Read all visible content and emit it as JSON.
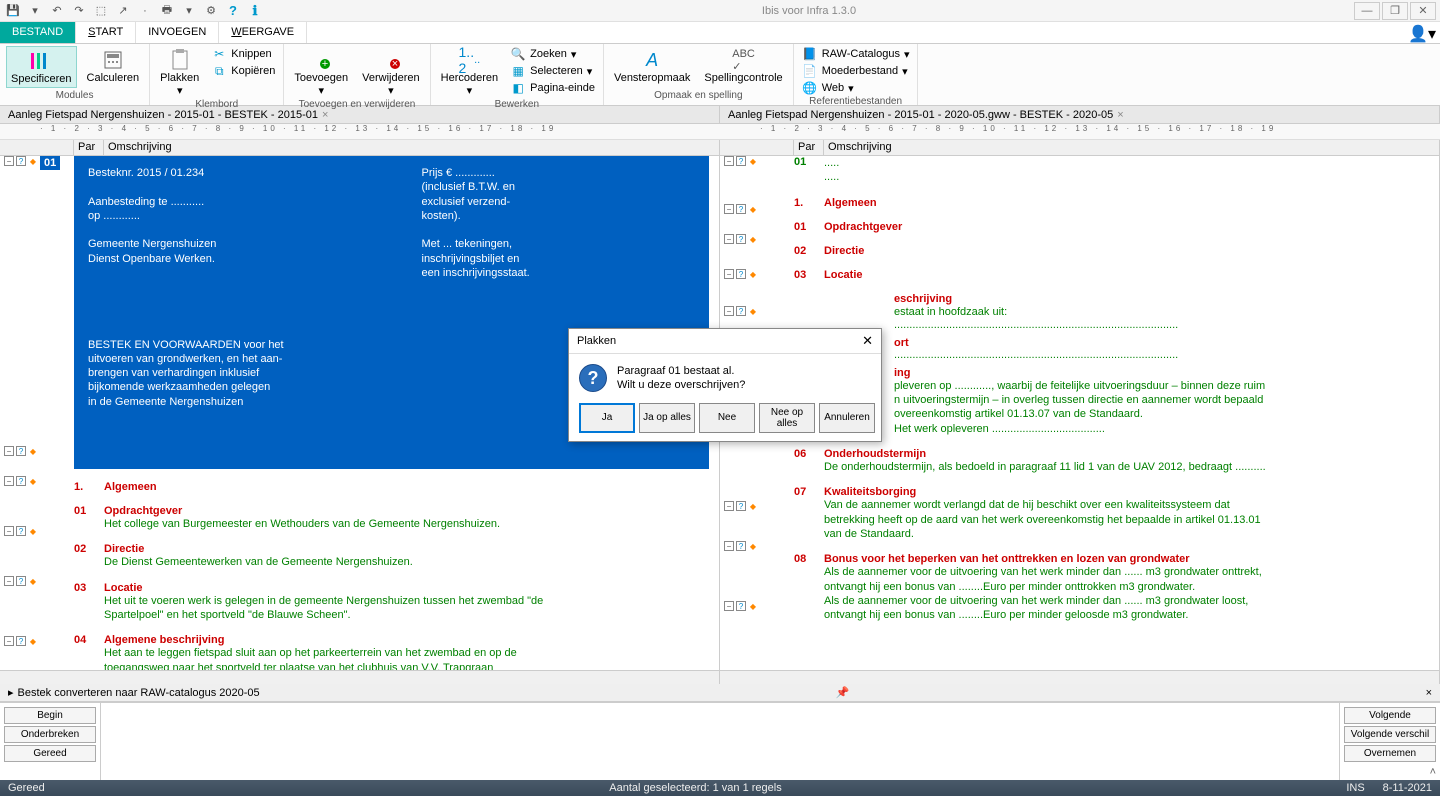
{
  "app_title": "Ibis voor Infra 1.3.0",
  "menu_tabs": {
    "bestand": "BESTAND",
    "start": "START",
    "invoegen": "INVOEGEN",
    "weergave": "WEERGAVE"
  },
  "ribbon": {
    "modules": {
      "label": "Modules",
      "specificeren": "Specificeren",
      "calculeren": "Calculeren"
    },
    "klembord": {
      "label": "Klembord",
      "plakken": "Plakken",
      "knippen": "Knippen",
      "kopieren": "Kopiëren"
    },
    "toevoegen_verwijderen": {
      "label": "Toevoegen en verwijderen",
      "toevoegen": "Toevoegen",
      "verwijderen": "Verwijderen"
    },
    "bewerken": {
      "label": "Bewerken",
      "hercoderen": "Hercoderen",
      "zoeken": "Zoeken",
      "selecteren": "Selecteren",
      "pagina_einde": "Pagina-einde"
    },
    "opmaak": {
      "label": "Opmaak en spelling",
      "vensteropmaak": "Vensteropmaak",
      "spellingcontrole": "Spellingcontrole"
    },
    "referentie": {
      "label": "Referentiebestanden",
      "raw": "RAW-Catalogus",
      "moeder": "Moederbestand",
      "web": "Web"
    }
  },
  "doc_tabs": {
    "left": "Aanleg Fietspad Nergenshuizen - 2015-01 - BESTEK - 2015-01",
    "right": "Aanleg Fietspad Nergenshuizen - 2015-01 - 2020-05.gww - BESTEK - 2020-05"
  },
  "col_headers": {
    "par": "Par",
    "omschrijving": "Omschrijving"
  },
  "left_doc": {
    "par01": "01",
    "blue": {
      "besteknr": "Besteknr. 2015 / 01.234",
      "aanbesteding": "Aanbesteding te ...........",
      "op": "op ............",
      "gemeente": "Gemeente Nergenshuizen",
      "dienst": "Dienst Openbare Werken.",
      "voorwaarden1": "BESTEK EN VOORWAARDEN voor het",
      "voorwaarden2": "uitvoeren van grondwerken, en het aan-",
      "voorwaarden3": "brengen van verhardingen inklusief",
      "voorwaarden4": "bijkomende werkzaamheden gelegen",
      "voorwaarden5": "in de Gemeente Nergenshuizen",
      "prijs": "Prijs € .............",
      "incl": "(inclusief B.T.W. en",
      "excl": "exclusief verzend-",
      "kosten": "kosten).",
      "met": "Met ... tekeningen,",
      "inschr": "inschrijvingsbiljet en",
      "staat": "een inschrijvingsstaat."
    },
    "sections": [
      {
        "num": "1.",
        "title": "Algemeen"
      },
      {
        "num": "01",
        "title": "Opdrachtgever",
        "body": "Het college van Burgemeester en Wethouders van de Gemeente Nergenshuizen."
      },
      {
        "num": "02",
        "title": "Directie",
        "body": "De Dienst Gemeentewerken van de Gemeente Nergenshuizen."
      },
      {
        "num": "03",
        "title": "Locatie",
        "body1": "Het uit te voeren werk is gelegen in de gemeente Nergenshuizen tussen het zwembad \"de",
        "body2": "Spartelpoel\" en het sportveld \"de Blauwe Scheen\"."
      },
      {
        "num": "04",
        "title": "Algemene beschrijving",
        "body1": "Het aan te leggen fietspad sluit aan op het parkeerterrein van het zwembad en op de",
        "body2": "toegangsweg naar het sportveld ter plaatse van het clubhuis van V.V. Trapgraan"
      }
    ]
  },
  "right_doc": {
    "sections": [
      {
        "num": "01",
        "title": ".....",
        "body": "....."
      },
      {
        "num": "1.",
        "title": "Algemeen"
      },
      {
        "num": "01",
        "title": "Opdrachtgever"
      },
      {
        "num": "02",
        "title": "Directie"
      },
      {
        "num": "03",
        "title": "Locatie"
      }
    ],
    "extra": {
      "beschrijving_title": "eschrijving",
      "beschrijving_body": "estaat in hoofdzaak uit:",
      "dots1": ".............................................................................................",
      "ort": "ort",
      "dots2": ".............................................................................................",
      "ing": "ing",
      "s5b1": "pleveren op ............, waarbij de feitelijke uitvoeringsduur – binnen deze ruim",
      "s5b2": "n uitvoeringstermijn – in overleg tussen directie en aannemer wordt bepaald",
      "s5b3": "overeenkomstig artikel 01.13.07 van de Standaard.",
      "s5b4": "Het werk opleveren .....................................",
      "s06n": "06",
      "s06t": "Onderhoudstermijn",
      "s06b": "De onderhoudstermijn, als bedoeld in paragraaf 11 lid 1 van de UAV 2012, bedraagt ..........",
      "s07n": "07",
      "s07t": "Kwaliteitsborging",
      "s07b1": "Van de aannemer wordt verlangd dat de hij beschikt over een kwaliteitssysteem dat",
      "s07b2": "betrekking heeft op de aard van het werk overeenkomstig het bepaalde in artikel 01.13.01",
      "s07b3": "van de Standaard.",
      "s08n": "08",
      "s08t": "Bonus voor het beperken van het onttrekken en lozen van grondwater",
      "s08b1": "Als de aannemer voor de uitvoering van het werk minder dan ...... m3 grondwater onttrekt,",
      "s08b2": "ontvangt hij een bonus van ........Euro per minder onttrokken m3 grondwater.",
      "s08b3": "Als de aannemer voor de uitvoering van het werk minder dan ...... m3 grondwater loost,",
      "s08b4": "ontvangt hij een bonus van ........Euro per minder geloosde m3 grondwater."
    }
  },
  "task_tab": "Bestek converteren naar RAW-catalogus 2020-05",
  "bottom_buttons": {
    "begin": "Begin",
    "onderbreken": "Onderbreken",
    "gereed": "Gereed",
    "volgende": "Volgende",
    "volgende_verschil": "Volgende verschil",
    "overnemen": "Overnemen"
  },
  "status": {
    "left": "Gereed",
    "center": "Aantal geselecteerd: 1 van 1 regels",
    "ins": "INS",
    "date": "8-11-2021"
  },
  "dialog": {
    "title": "Plakken",
    "msg1": "Paragraaf 01 bestaat al.",
    "msg2": "Wilt u deze overschrijven?",
    "ja": "Ja",
    "ja_op_alles": "Ja op alles",
    "nee": "Nee",
    "nee_op_alles": "Nee op alles",
    "annuleren": "Annuleren"
  }
}
